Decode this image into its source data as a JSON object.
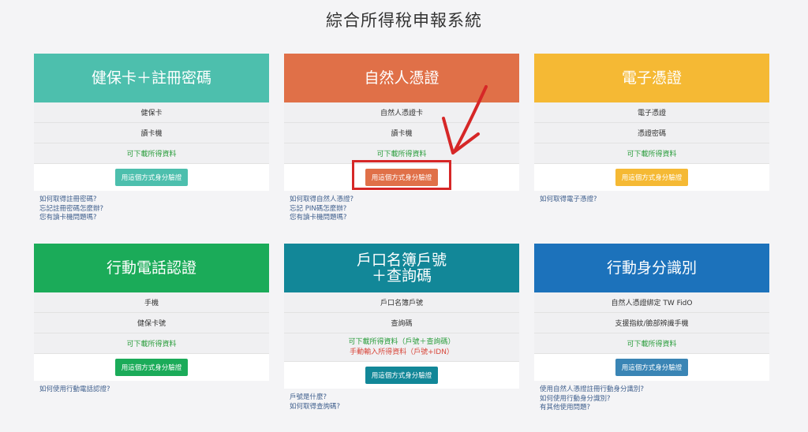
{
  "title": "綜合所得稅申報系統",
  "colors": {
    "teal": "#4dbfad",
    "orange": "#e07048",
    "yellow": "#f5b934",
    "green": "#1bab59",
    "cyan": "#128798",
    "blue": "#1c72bb",
    "highlight_red": "#d62727"
  },
  "cards": [
    {
      "title": "健保卡＋註冊密碼",
      "rows": [
        "健保卡",
        "讀卡機"
      ],
      "notes": [
        "可下載所得資料"
      ],
      "button": "用這個方式身分驗證",
      "links": [
        "如何取得註冊密碼?",
        "忘記註冊密碼怎麼辦?",
        "您有讀卡機問題嗎?"
      ]
    },
    {
      "title": "自然人憑證",
      "rows": [
        "自然人憑證卡",
        "讀卡機"
      ],
      "notes": [
        "可下載所得資料"
      ],
      "button": "用這個方式身分驗證",
      "links": [
        "如何取得自然人憑證?",
        "忘記 PIN碼怎麼辦?",
        "您有讀卡機問題嗎?"
      ]
    },
    {
      "title": "電子憑證",
      "rows": [
        "電子憑證",
        "憑證密碼"
      ],
      "notes": [
        "可下載所得資料"
      ],
      "button": "用這個方式身分驗證",
      "links": [
        "如何取得電子憑證?"
      ]
    },
    {
      "title": "行動電話認證",
      "rows": [
        "手機",
        "健保卡號"
      ],
      "notes": [
        "可下載所得資料"
      ],
      "button": "用這個方式身分驗證",
      "links": [
        "如何使用行動電話認證?"
      ]
    },
    {
      "title": "戶口名簿戶號\n＋查詢碼",
      "rows": [
        "戶口名簿戶號",
        "查詢碼"
      ],
      "notes": [
        "可下載所得資料（戶號＋查詢碼）",
        "手動輸入所得資料（戶號+IDN）"
      ],
      "button": "用這個方式身分驗證",
      "links": [
        "戶號是什麼?",
        "如何取得查詢碼?"
      ]
    },
    {
      "title": "行動身分識別",
      "rows": [
        "自然人憑證綁定 TW FidO",
        "支援指紋/臉部辨識手機"
      ],
      "notes": [
        "可下載所得資料"
      ],
      "button": "用這個方式身分驗證",
      "links": [
        "使用自然人憑證註冊行動身分識別?",
        "如何使用行動身分識別?",
        "有其他使用問題?"
      ]
    }
  ]
}
